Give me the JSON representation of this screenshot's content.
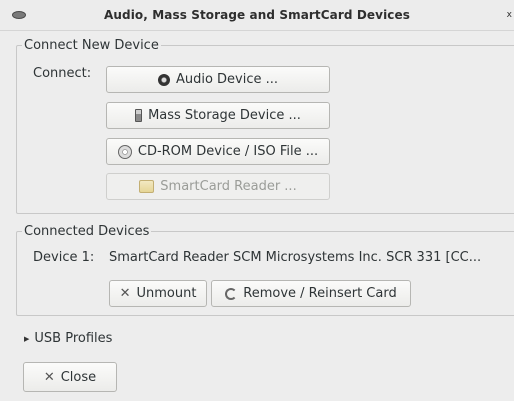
{
  "window": {
    "title": "Audio, Mass Storage and SmartCard Devices",
    "close_glyph": "x"
  },
  "connect_section": {
    "legend": "Connect New Device",
    "connect_label": "Connect:",
    "buttons": [
      {
        "label": "Audio Device ...",
        "icon": "speaker-icon",
        "enabled": true
      },
      {
        "label": "Mass Storage Device ...",
        "icon": "usb-drive-icon",
        "enabled": true
      },
      {
        "label": "CD-ROM Device / ISO File ...",
        "icon": "cdrom-icon",
        "enabled": true
      },
      {
        "label": "SmartCard Reader ...",
        "icon": "smartcard-icon",
        "enabled": false
      }
    ]
  },
  "connected_section": {
    "legend": "Connected Devices",
    "device_label": "Device 1:",
    "device_name": "SmartCard Reader SCM Microsystems Inc. SCR 331 [CC...",
    "unmount_label": "Unmount",
    "reinsert_label": "Remove / Reinsert Card"
  },
  "usb_profiles": {
    "label": "USB Profiles",
    "expanded": false
  },
  "footer": {
    "close_label": "Close"
  }
}
